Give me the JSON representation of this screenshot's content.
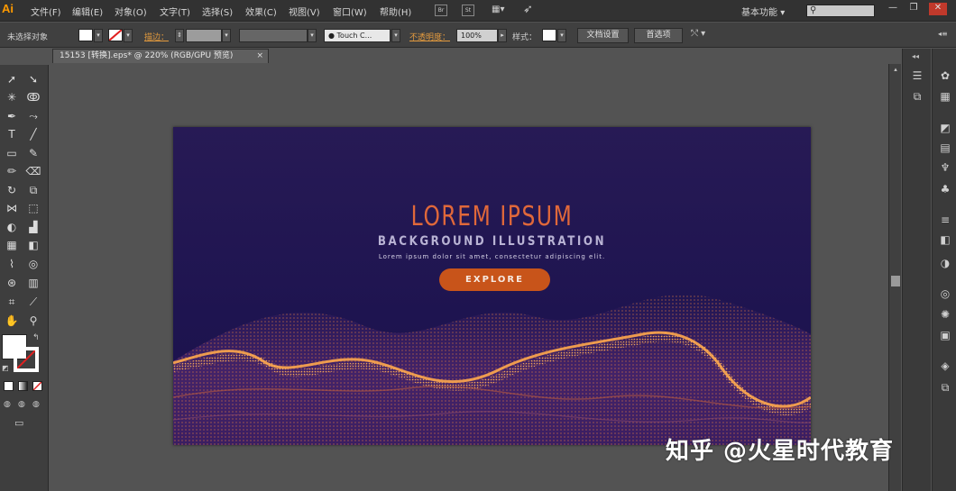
{
  "app": {
    "logo": "Ai"
  },
  "menu": {
    "items": [
      "文件(F)",
      "编辑(E)",
      "对象(O)",
      "文字(T)",
      "选择(S)",
      "效果(C)",
      "视图(V)",
      "窗口(W)",
      "帮助(H)"
    ],
    "bridge_label": "Br",
    "stock_label": "St",
    "workspace": "基本功能",
    "workspace_arrow": "▾"
  },
  "window_controls": {
    "minimize": "—",
    "restore": "❐",
    "close": "✕"
  },
  "control_bar": {
    "selection_status": "未选择对象",
    "stroke_label": "描边：",
    "brush_value": "Touch C...",
    "opacity_label": "不透明度：",
    "opacity_value": "100%",
    "style_label": "样式：",
    "doc_setup_button": "文档设置",
    "preferences_button": "首选项"
  },
  "document_tab": {
    "title": "15153 [转换].eps* @ 220% (RGB/GPU 预览)",
    "close": "×"
  },
  "artwork": {
    "title": "LOREM IPSUM",
    "subtitle": "BACKGROUND ILLUSTRATION",
    "description": "Lorem ipsum dolor sit amet, consectetur adipiscing elit.",
    "button_label": "EXPLORE",
    "colors": {
      "background": "#1e1450",
      "title": "#e0683a",
      "button": "#c8541a",
      "wave": "#f08a3c"
    }
  },
  "watermark": "知乎 @火星时代教育",
  "colors": {
    "accent": "#ff9a00",
    "ui_bg": "#535353",
    "panel_bg": "#3e3e3e"
  }
}
